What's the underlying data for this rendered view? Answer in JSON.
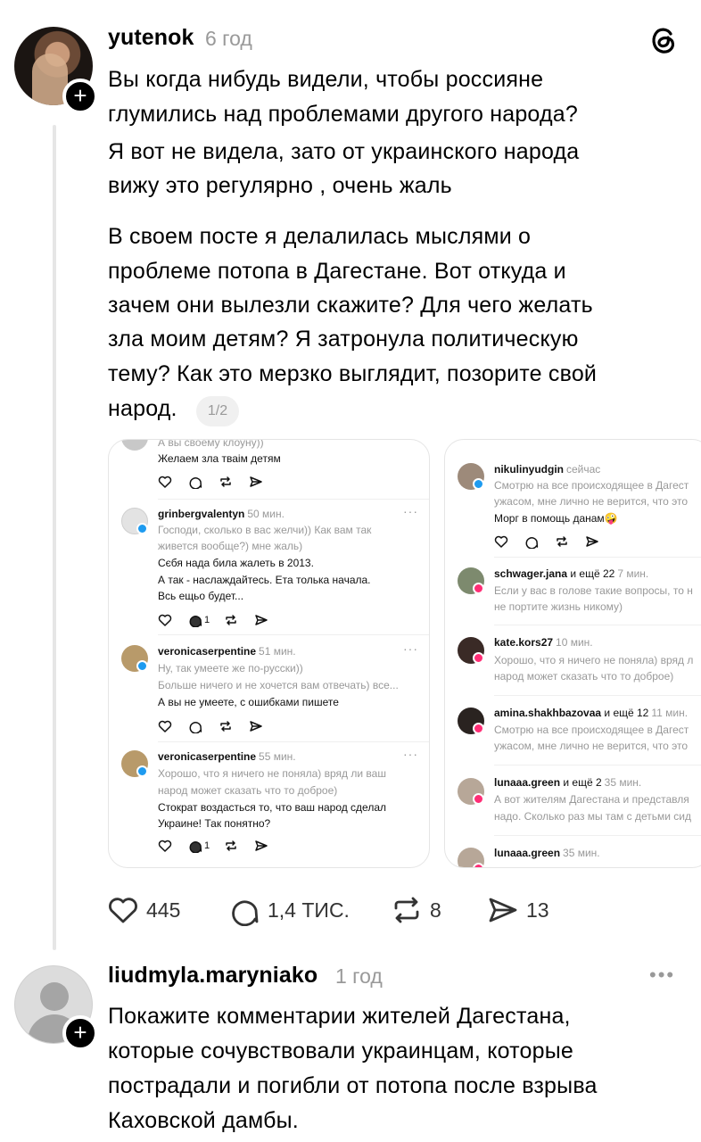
{
  "post": {
    "username": "yutenok",
    "time": "6 год",
    "lines": [
      "Вы когда нибудь видели, чтобы россияне",
      "глумились над проблемами другого народа?",
      "Я вот не видела, зато от украинского народа",
      "вижу это регулярно , очень жаль",
      "В своем посте я делалилась мыслями о",
      "проблеме потопа в Дагестане. Вот откуда и",
      "зачем они вылезли скажите? Для чего желать",
      "зла моим детям? Я затронула политическую",
      "тему? Как это мерзко выглядит, позорите свой",
      "народ."
    ],
    "page_indicator": "1/2",
    "likes": "445",
    "replies": "1,4 ТИС.",
    "reposts": "8",
    "shares": "13"
  },
  "shot_a": {
    "c0": {
      "quote": "А вы своему клоуну))",
      "text": "Желаем зла тваім детям"
    },
    "c1": {
      "user": "grinbergvalentyn",
      "time": "50 мин.",
      "quote1": "Господи, сколько в вас желчи)) Как вам так",
      "quote2": "живется вообще?) мне жаль)",
      "text1": "Сєбя нада била жалеть в 2013.",
      "text2": "А так - наслаждайтесь. Ета толька начала.",
      "text3": "Всь ещьо будет...",
      "count": "1"
    },
    "c2": {
      "user": "veronicaserpentine",
      "time": "51 мин.",
      "quote1": "Ну, так умеете же по-русски))",
      "quote2": "Больше ничего и не хочется вам отвечать) все...",
      "text1": "А вы не умеете, с ошибками пишете"
    },
    "c3": {
      "user": "veronicaserpentine",
      "time": "55 мин.",
      "quote1": "Хорошо, что я ничего не поняла) вряд ли ваш",
      "quote2": "народ может сказать что то доброе)",
      "text1": "Стократ воздасться то, что ваш народ сделал",
      "text2": "Украине! Так понятно?",
      "count": "1"
    }
  },
  "shot_b": {
    "c0": {
      "user": "nikulinyudgin",
      "time": "сейчас",
      "quote1": "Смотрю на все происходящее в Дагест",
      "quote2": "ужасом, мне лично не верится, что это",
      "text1": "Морг в помощь данам🤪"
    },
    "c1": {
      "user": "schwager.jana",
      "and": "и ещё 22",
      "time": "7 мин.",
      "quote1": "Если у вас в голове такие вопросы, то н",
      "quote2": "не портите жизнь никому)"
    },
    "c2": {
      "user": "kate.kors27",
      "time": "10 мин.",
      "quote1": "Хорошо, что я ничего не поняла) вряд л",
      "quote2": "народ может сказать что то доброе)"
    },
    "c3": {
      "user": "amina.shakhbazovaa",
      "and": "и ещё 12",
      "time": "11 мин.",
      "quote1": "Смотрю на все происходящее в Дагест",
      "quote2": "ужасом, мне лично не верится, что это"
    },
    "c4": {
      "user": "lunaaa.green",
      "and": "и ещё 2",
      "time": "35 мин.",
      "quote1": "А вот жителям Дагестана и представля",
      "quote2": "надо. Сколько раз мы там с детьми сид"
    },
    "c5": {
      "user": "lunaaa.green",
      "time": "35 мин."
    }
  },
  "reply": {
    "username": "liudmyla.maryniako",
    "time": "1 год",
    "lines": [
      "Покажите комментарии жителей Дагестана,",
      "которые сочувствовали украинцам, которые",
      "пострадали и погибли от потопа после взрыва",
      "Каховской дамбы."
    ]
  },
  "colors": {
    "accent_blue": "#1e9bf0",
    "accent_pink": "#ff2d75",
    "muted": "#999999"
  },
  "icons": [
    "threads-logo",
    "heart-icon",
    "comment-icon",
    "repost-icon",
    "share-icon",
    "plus-icon",
    "more-icon"
  ]
}
